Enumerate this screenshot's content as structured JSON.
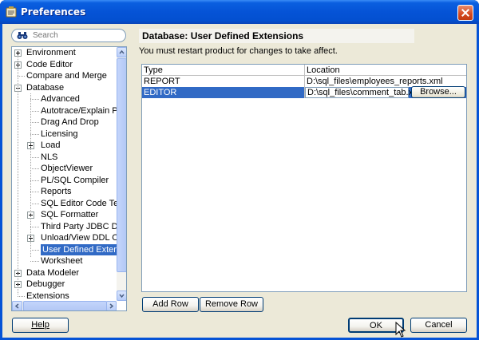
{
  "window": {
    "title": "Preferences"
  },
  "search": {
    "placeholder": "Search"
  },
  "tree": {
    "items": [
      {
        "label": "Environment",
        "expander": "plus"
      },
      {
        "label": "Code Editor",
        "expander": "plus"
      },
      {
        "label": "Compare and Merge",
        "expander": ""
      },
      {
        "label": "Database",
        "expander": "minus"
      },
      {
        "label": "Advanced",
        "expander": ""
      },
      {
        "label": "Autotrace/Explain Plan",
        "expander": ""
      },
      {
        "label": "Drag And Drop",
        "expander": ""
      },
      {
        "label": "Licensing",
        "expander": ""
      },
      {
        "label": "Load",
        "expander": "plus"
      },
      {
        "label": "NLS",
        "expander": ""
      },
      {
        "label": "ObjectViewer",
        "expander": ""
      },
      {
        "label": "PL/SQL Compiler",
        "expander": ""
      },
      {
        "label": "Reports",
        "expander": ""
      },
      {
        "label": "SQL Editor Code Templa",
        "expander": ""
      },
      {
        "label": "SQL Formatter",
        "expander": "plus"
      },
      {
        "label": "Third Party JDBC Driver",
        "expander": ""
      },
      {
        "label": "Unload/View DDL Option",
        "expander": "plus"
      },
      {
        "label": "User Defined Extension",
        "expander": "",
        "selected": true
      },
      {
        "label": "Worksheet",
        "expander": ""
      },
      {
        "label": "Data Modeler",
        "expander": "plus"
      },
      {
        "label": "Debugger",
        "expander": "plus"
      },
      {
        "label": "Extensions",
        "expander": ""
      }
    ]
  },
  "page": {
    "title": "Database: User Defined Extensions",
    "note": "You must restart product for changes to take affect."
  },
  "table": {
    "headers": {
      "type": "Type",
      "location": "Location"
    },
    "rows": [
      {
        "type": "REPORT",
        "location": "D:\\sql_files\\employees_reports.xml"
      },
      {
        "type": "EDITOR",
        "location": "D:\\sql_files\\comment_tab.xml"
      }
    ],
    "browse_label": "Browse..."
  },
  "buttons": {
    "add_row": "Add Row",
    "remove_row": "Remove Row",
    "help": "Help",
    "ok": "OK",
    "cancel": "Cancel"
  },
  "colors": {
    "titlebar": "#0553d6",
    "selection": "#316ac5",
    "dialog_bg": "#ece9d8"
  }
}
